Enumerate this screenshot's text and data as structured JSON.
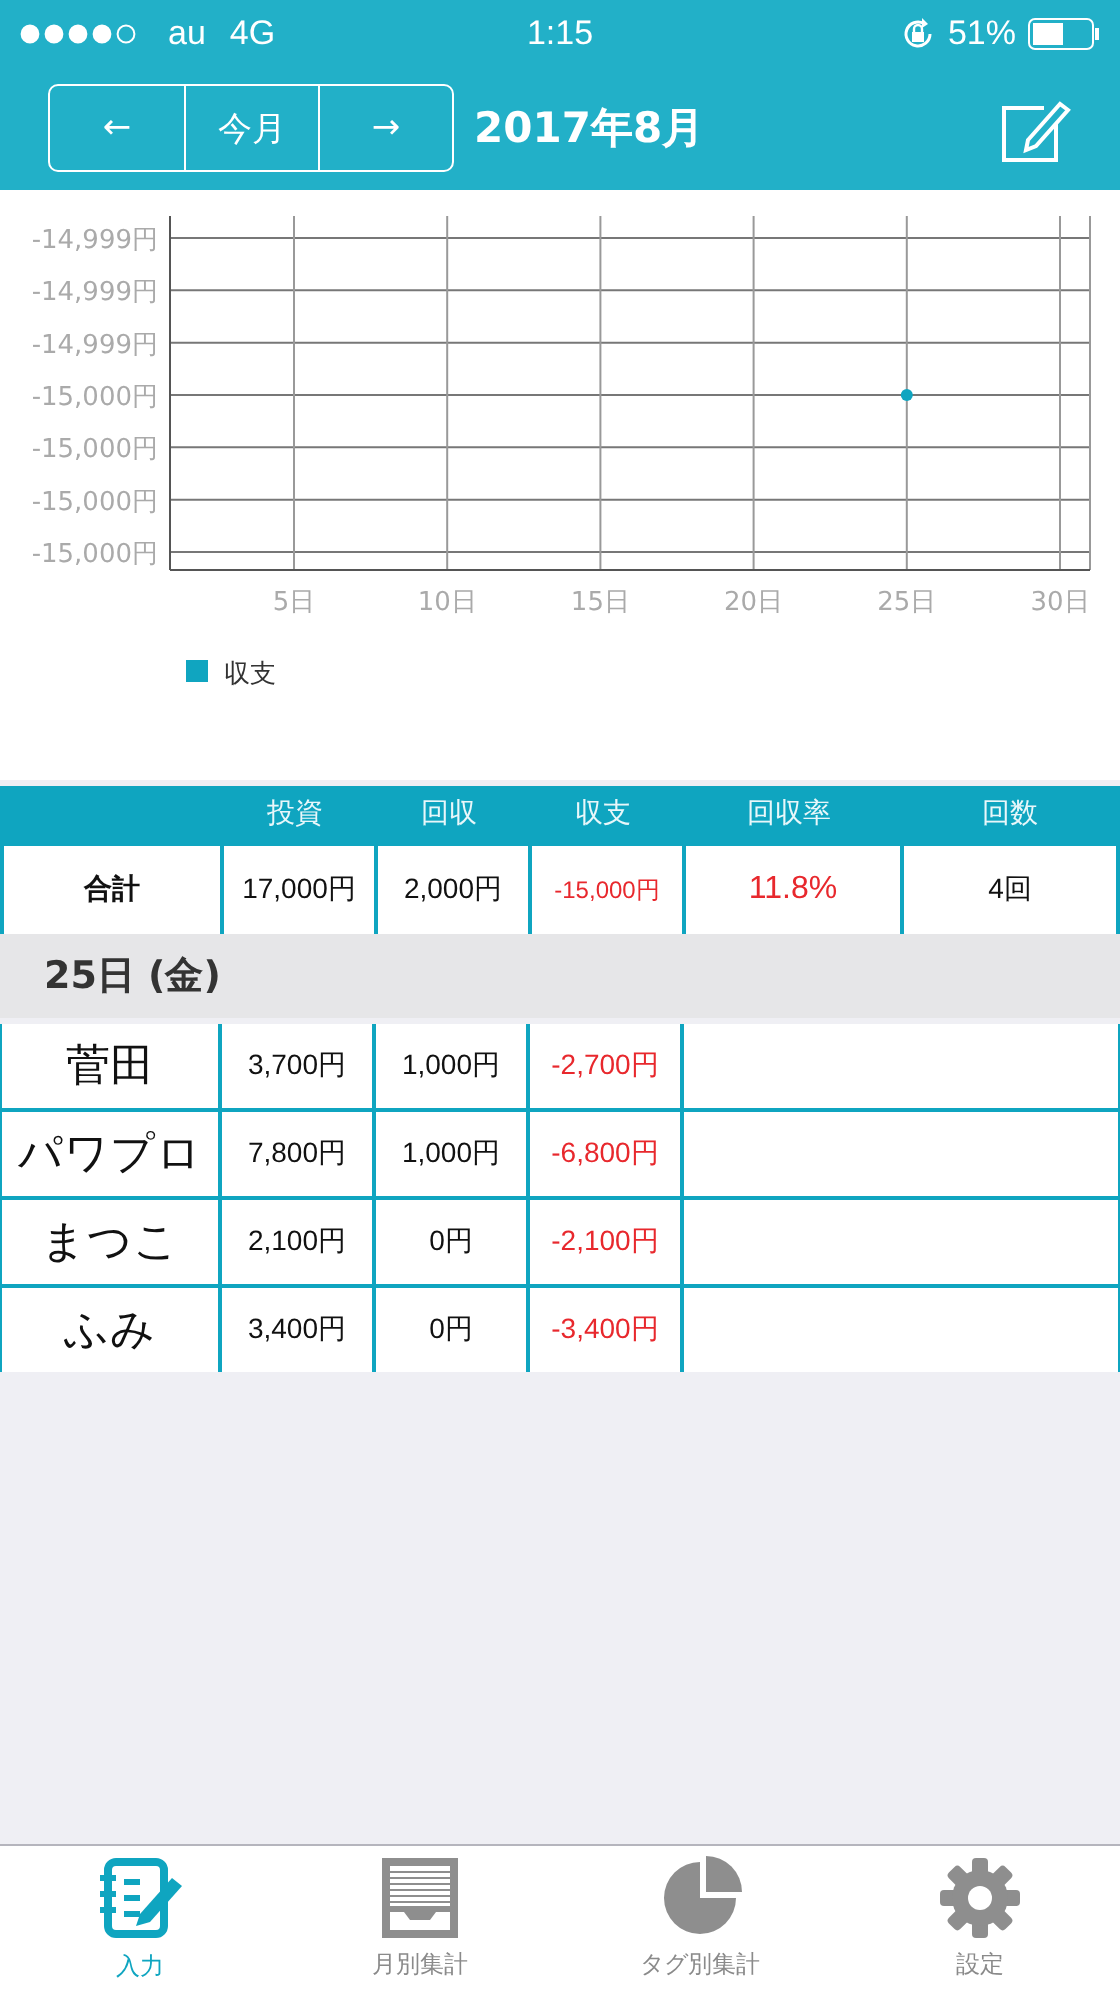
{
  "status_bar": {
    "carrier": "au",
    "network": "4G",
    "time": "1:15",
    "battery": "51%"
  },
  "nav": {
    "buttons": [
      "←",
      "今月",
      "→"
    ],
    "title": "2017年8月"
  },
  "chart": {
    "y_labels": [
      "-14,999円",
      "-14,999円",
      "-14,999円",
      "-15,000円",
      "-15,000円",
      "-15,000円",
      "-15,000円"
    ],
    "x_labels": [
      "5日",
      "10日",
      "15日",
      "20日",
      "25日",
      "30日"
    ],
    "legend": "収支"
  },
  "summary_table": {
    "columns": [
      "投資",
      "回収",
      "収支",
      "回収率",
      "回数"
    ],
    "total_row": {
      "label": "合計",
      "cells": [
        {
          "text": "17,000円",
          "negative": false
        },
        {
          "text": "2,000円",
          "negative": false
        },
        {
          "text": "-15,000円",
          "negative": true
        },
        {
          "text": "11.8%",
          "negative": true
        },
        {
          "text": "4回",
          "negative": false
        }
      ]
    }
  },
  "day_group": {
    "heading": "25日 (金)",
    "rows": [
      {
        "name": "菅田",
        "cells": [
          {
            "text": "3,700円",
            "negative": false
          },
          {
            "text": "1,000円",
            "negative": false
          },
          {
            "text": "-2,700円",
            "negative": true
          }
        ]
      },
      {
        "name": "パワプロ",
        "cells": [
          {
            "text": "7,800円",
            "negative": false
          },
          {
            "text": "1,000円",
            "negative": false
          },
          {
            "text": "-6,800円",
            "negative": true
          }
        ]
      },
      {
        "name": "まつこ",
        "cells": [
          {
            "text": "2,100円",
            "negative": false
          },
          {
            "text": "0円",
            "negative": false
          },
          {
            "text": "-2,100円",
            "negative": true
          }
        ]
      },
      {
        "name": "ふみ",
        "cells": [
          {
            "text": "3,400円",
            "negative": false
          },
          {
            "text": "0円",
            "negative": false
          },
          {
            "text": "-3,400円",
            "negative": true
          }
        ]
      }
    ]
  },
  "tab_bar": {
    "items": [
      {
        "kind": "input",
        "label": "入力",
        "selected": true
      },
      {
        "kind": "monthly",
        "label": "月別集計",
        "selected": false
      },
      {
        "kind": "tags",
        "label": "タグ別集計",
        "selected": false
      },
      {
        "kind": "settings",
        "label": "設定",
        "selected": false
      }
    ]
  }
}
